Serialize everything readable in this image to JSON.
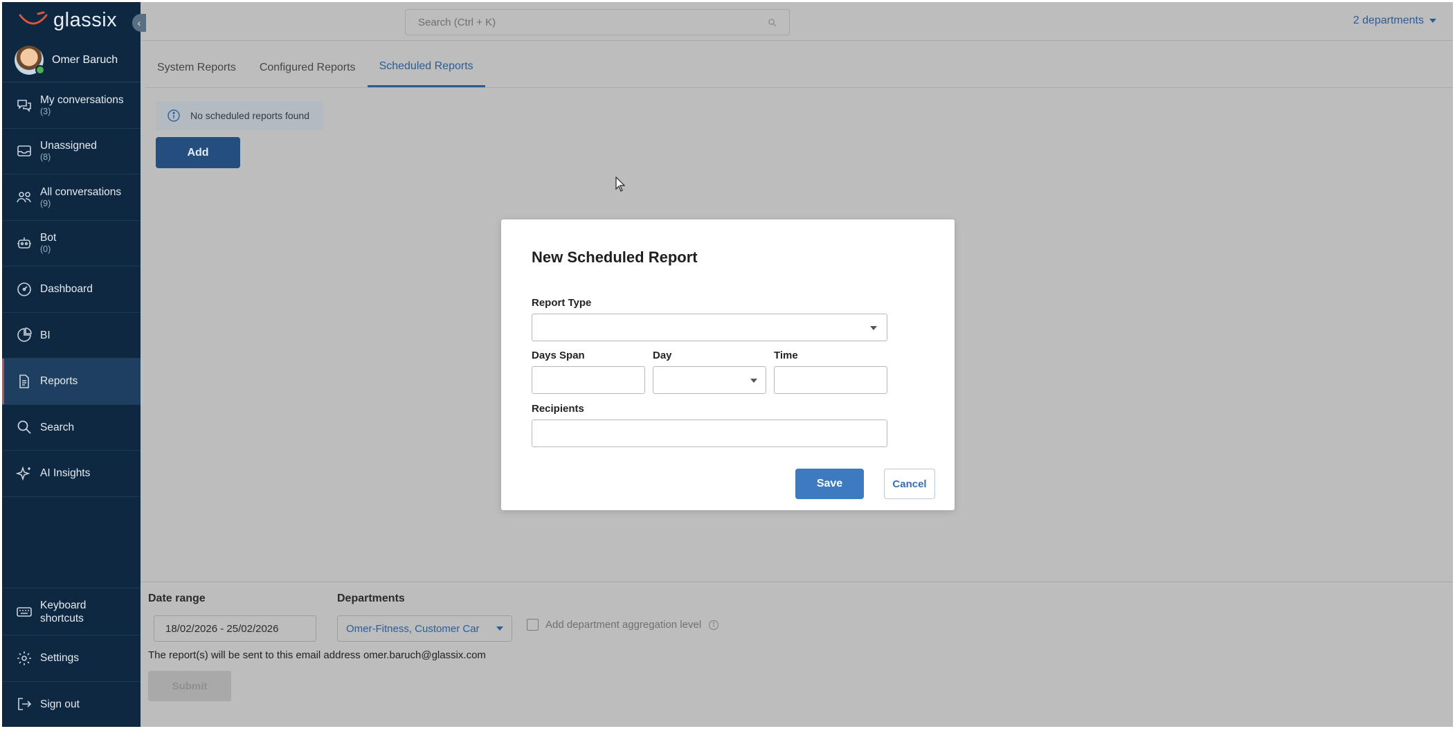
{
  "brand": {
    "name": "glassix"
  },
  "user": {
    "name": "Omer Baruch"
  },
  "sidebar": {
    "items": [
      {
        "label": "My conversations",
        "count": "(3)",
        "icon": "chat-bubbles-icon"
      },
      {
        "label": "Unassigned",
        "count": "(8)",
        "icon": "inbox-icon"
      },
      {
        "label": "All conversations",
        "count": "(9)",
        "icon": "people-icon"
      },
      {
        "label": "Bot",
        "count": "(0)",
        "icon": "robot-icon"
      },
      {
        "label": "Dashboard",
        "count": "",
        "icon": "gauge-icon"
      },
      {
        "label": "BI",
        "count": "",
        "icon": "pie-chart-icon"
      },
      {
        "label": "Reports",
        "count": "",
        "icon": "document-icon",
        "active": true
      },
      {
        "label": "Search",
        "count": "",
        "icon": "search-icon"
      },
      {
        "label": "AI Insights",
        "count": "",
        "icon": "sparkle-icon"
      }
    ],
    "bottom": [
      {
        "label": "Keyboard shortcuts",
        "icon": "keyboard-icon"
      },
      {
        "label": "Settings",
        "icon": "gear-icon"
      },
      {
        "label": "Sign out",
        "icon": "sign-out-icon"
      }
    ]
  },
  "topbar": {
    "search_placeholder": "Search (Ctrl + K)",
    "departments": "2 departments"
  },
  "tabs": [
    {
      "label": "System Reports",
      "active": false
    },
    {
      "label": "Configured Reports",
      "active": false
    },
    {
      "label": "Scheduled Reports",
      "active": true
    }
  ],
  "main": {
    "notice": "No scheduled reports found",
    "add_label": "Add"
  },
  "modal": {
    "title": "New Scheduled Report",
    "report_type_label": "Report Type",
    "report_type_value": "",
    "days_span_label": "Days Span",
    "day_label": "Day",
    "time_label": "Time",
    "recipients_label": "Recipients",
    "save_label": "Save",
    "cancel_label": "Cancel"
  },
  "filters": {
    "date_range_label": "Date range",
    "date_range_value": "18/02/2026 - 25/02/2026",
    "departments_label": "Departments",
    "departments_value": "Omer-Fitness, Customer Car",
    "aggregation_label": "Add department aggregation level",
    "email_note": "The report(s) will be sent to this email address omer.baruch@glassix.com",
    "submit_label": "Submit"
  },
  "colors": {
    "sidebar_bg": "#0e2841",
    "accent": "#285d97",
    "overlay_bg": "#bdbdbd",
    "save_button": "#3e7ac0"
  }
}
